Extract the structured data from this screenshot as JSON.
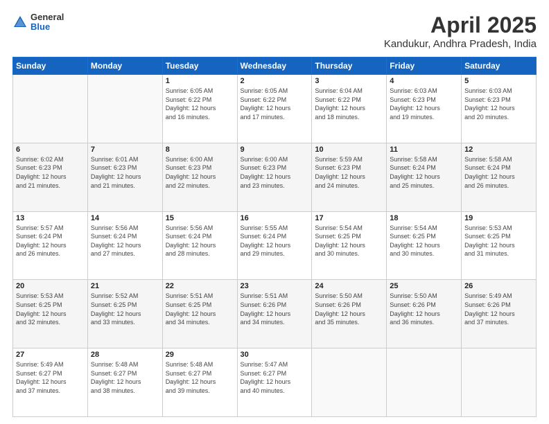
{
  "header": {
    "logo": {
      "line1": "General",
      "line2": "Blue"
    },
    "title": "April 2025",
    "location": "Kandukur, Andhra Pradesh, India"
  },
  "weekdays": [
    "Sunday",
    "Monday",
    "Tuesday",
    "Wednesday",
    "Thursday",
    "Friday",
    "Saturday"
  ],
  "weeks": [
    [
      {
        "day": "",
        "info": ""
      },
      {
        "day": "",
        "info": ""
      },
      {
        "day": "1",
        "info": "Sunrise: 6:05 AM\nSunset: 6:22 PM\nDaylight: 12 hours\nand 16 minutes."
      },
      {
        "day": "2",
        "info": "Sunrise: 6:05 AM\nSunset: 6:22 PM\nDaylight: 12 hours\nand 17 minutes."
      },
      {
        "day": "3",
        "info": "Sunrise: 6:04 AM\nSunset: 6:22 PM\nDaylight: 12 hours\nand 18 minutes."
      },
      {
        "day": "4",
        "info": "Sunrise: 6:03 AM\nSunset: 6:23 PM\nDaylight: 12 hours\nand 19 minutes."
      },
      {
        "day": "5",
        "info": "Sunrise: 6:03 AM\nSunset: 6:23 PM\nDaylight: 12 hours\nand 20 minutes."
      }
    ],
    [
      {
        "day": "6",
        "info": "Sunrise: 6:02 AM\nSunset: 6:23 PM\nDaylight: 12 hours\nand 21 minutes."
      },
      {
        "day": "7",
        "info": "Sunrise: 6:01 AM\nSunset: 6:23 PM\nDaylight: 12 hours\nand 21 minutes."
      },
      {
        "day": "8",
        "info": "Sunrise: 6:00 AM\nSunset: 6:23 PM\nDaylight: 12 hours\nand 22 minutes."
      },
      {
        "day": "9",
        "info": "Sunrise: 6:00 AM\nSunset: 6:23 PM\nDaylight: 12 hours\nand 23 minutes."
      },
      {
        "day": "10",
        "info": "Sunrise: 5:59 AM\nSunset: 6:23 PM\nDaylight: 12 hours\nand 24 minutes."
      },
      {
        "day": "11",
        "info": "Sunrise: 5:58 AM\nSunset: 6:24 PM\nDaylight: 12 hours\nand 25 minutes."
      },
      {
        "day": "12",
        "info": "Sunrise: 5:58 AM\nSunset: 6:24 PM\nDaylight: 12 hours\nand 26 minutes."
      }
    ],
    [
      {
        "day": "13",
        "info": "Sunrise: 5:57 AM\nSunset: 6:24 PM\nDaylight: 12 hours\nand 26 minutes."
      },
      {
        "day": "14",
        "info": "Sunrise: 5:56 AM\nSunset: 6:24 PM\nDaylight: 12 hours\nand 27 minutes."
      },
      {
        "day": "15",
        "info": "Sunrise: 5:56 AM\nSunset: 6:24 PM\nDaylight: 12 hours\nand 28 minutes."
      },
      {
        "day": "16",
        "info": "Sunrise: 5:55 AM\nSunset: 6:24 PM\nDaylight: 12 hours\nand 29 minutes."
      },
      {
        "day": "17",
        "info": "Sunrise: 5:54 AM\nSunset: 6:25 PM\nDaylight: 12 hours\nand 30 minutes."
      },
      {
        "day": "18",
        "info": "Sunrise: 5:54 AM\nSunset: 6:25 PM\nDaylight: 12 hours\nand 30 minutes."
      },
      {
        "day": "19",
        "info": "Sunrise: 5:53 AM\nSunset: 6:25 PM\nDaylight: 12 hours\nand 31 minutes."
      }
    ],
    [
      {
        "day": "20",
        "info": "Sunrise: 5:53 AM\nSunset: 6:25 PM\nDaylight: 12 hours\nand 32 minutes."
      },
      {
        "day": "21",
        "info": "Sunrise: 5:52 AM\nSunset: 6:25 PM\nDaylight: 12 hours\nand 33 minutes."
      },
      {
        "day": "22",
        "info": "Sunrise: 5:51 AM\nSunset: 6:25 PM\nDaylight: 12 hours\nand 34 minutes."
      },
      {
        "day": "23",
        "info": "Sunrise: 5:51 AM\nSunset: 6:26 PM\nDaylight: 12 hours\nand 34 minutes."
      },
      {
        "day": "24",
        "info": "Sunrise: 5:50 AM\nSunset: 6:26 PM\nDaylight: 12 hours\nand 35 minutes."
      },
      {
        "day": "25",
        "info": "Sunrise: 5:50 AM\nSunset: 6:26 PM\nDaylight: 12 hours\nand 36 minutes."
      },
      {
        "day": "26",
        "info": "Sunrise: 5:49 AM\nSunset: 6:26 PM\nDaylight: 12 hours\nand 37 minutes."
      }
    ],
    [
      {
        "day": "27",
        "info": "Sunrise: 5:49 AM\nSunset: 6:27 PM\nDaylight: 12 hours\nand 37 minutes."
      },
      {
        "day": "28",
        "info": "Sunrise: 5:48 AM\nSunset: 6:27 PM\nDaylight: 12 hours\nand 38 minutes."
      },
      {
        "day": "29",
        "info": "Sunrise: 5:48 AM\nSunset: 6:27 PM\nDaylight: 12 hours\nand 39 minutes."
      },
      {
        "day": "30",
        "info": "Sunrise: 5:47 AM\nSunset: 6:27 PM\nDaylight: 12 hours\nand 40 minutes."
      },
      {
        "day": "",
        "info": ""
      },
      {
        "day": "",
        "info": ""
      },
      {
        "day": "",
        "info": ""
      }
    ]
  ]
}
